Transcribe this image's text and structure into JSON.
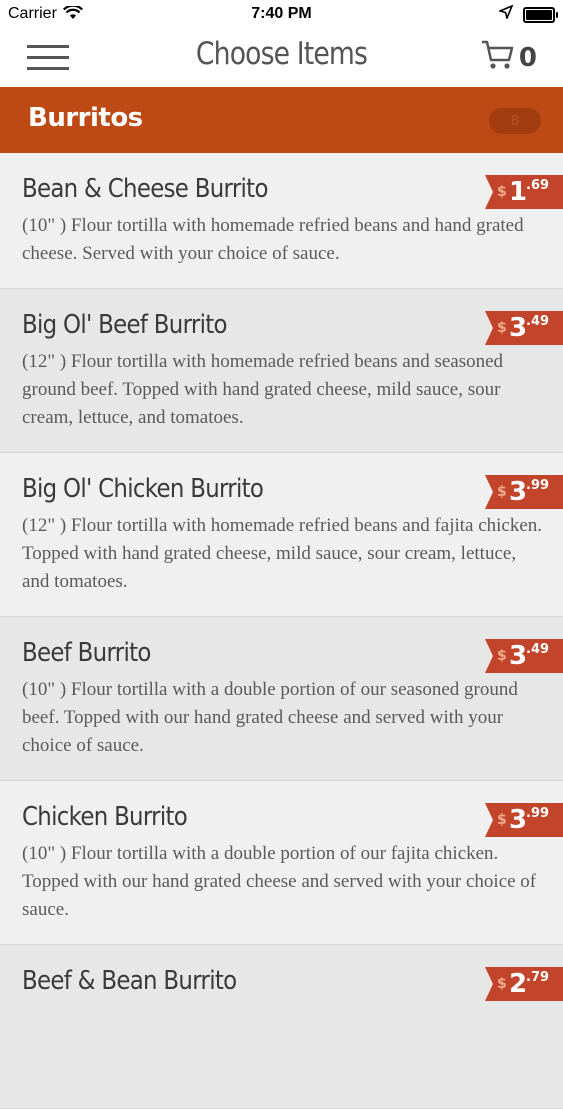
{
  "status": {
    "carrier": "Carrier",
    "time": "7:40 PM"
  },
  "nav": {
    "title": "Choose Items",
    "cart_count": "0"
  },
  "category": {
    "title": "Burritos",
    "badge": "8"
  },
  "items": [
    {
      "name": "Bean & Cheese Burrito",
      "description": "(10\" ) Flour tortilla with homemade refried beans and hand grated cheese. Served with your choice of sauce.",
      "price_dollar": "$",
      "price_whole": "1",
      "price_cents": ".69"
    },
    {
      "name": "Big Ol' Beef Burrito",
      "description": "(12\" ) Flour tortilla with homemade refried beans and seasoned ground beef. Topped with hand grated cheese, mild sauce, sour cream, lettuce, and tomatoes.",
      "price_dollar": "$",
      "price_whole": "3",
      "price_cents": ".49"
    },
    {
      "name": "Big Ol' Chicken Burrito",
      "description": "(12\" ) Flour tortilla with homemade refried beans and fajita chicken. Topped with hand grated cheese, mild sauce, sour cream, lettuce, and tomatoes.",
      "price_dollar": "$",
      "price_whole": "3",
      "price_cents": ".99"
    },
    {
      "name": "Beef Burrito",
      "description": "(10\" ) Flour tortilla with a double portion of our seasoned ground beef. Topped with our hand grated cheese and served with your choice of sauce.",
      "price_dollar": "$",
      "price_whole": "3",
      "price_cents": ".49"
    },
    {
      "name": "Chicken Burrito",
      "description": "(10\" ) Flour tortilla with a double portion of our fajita chicken. Topped with our hand grated cheese and served with your choice of sauce.",
      "price_dollar": "$",
      "price_whole": "3",
      "price_cents": ".99"
    },
    {
      "name": "Beef & Bean Burrito",
      "description": "",
      "price_dollar": "$",
      "price_whole": "2",
      "price_cents": ".79"
    }
  ],
  "colors": {
    "category_bar": "#bd4a15",
    "price_tag": "#c2452b"
  }
}
